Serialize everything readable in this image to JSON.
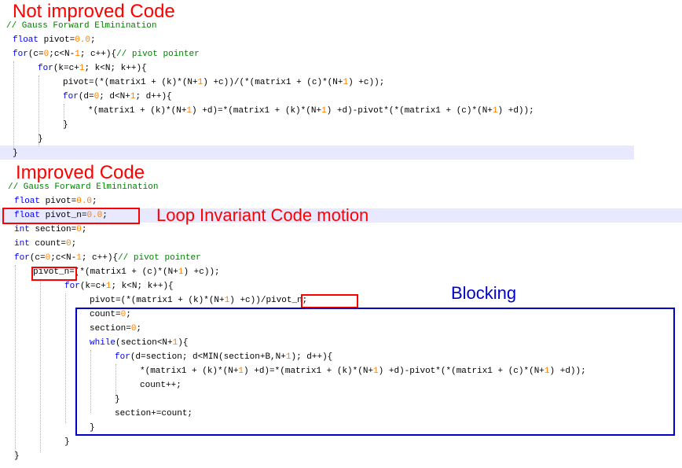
{
  "headings": {
    "not_improved": "Not improved Code",
    "improved": "Improved Code"
  },
  "annotations": {
    "loop_invariant": "Loop Invariant Code motion",
    "blocking": "Blocking"
  },
  "colors": {
    "heading": "#ff0000",
    "keyword": "#0000ff",
    "comment": "#008000",
    "number": "#ff8000",
    "loop_invariant_box": "#ff0000",
    "blocking_box": "#0000cc",
    "line_highlight": "#e8e8ff"
  },
  "code_before": [
    "// Gauss Forward Elminination",
    "float pivot=0.0;",
    "for(c=0;c<N-1; c++){// pivot pointer",
    "    for(k=c+1; k<N; k++){",
    "        pivot=(*(matrix1 + (k)*(N+1) +c))/(*(matrix1 + (c)*(N+1) +c));",
    "        for(d=0; d<N+1; d++){",
    "            *(matrix1 + (k)*(N+1) +d)=*(matrix1 + (k)*(N+1) +d)-pivot*(*(matrix1 + (c)*(N+1) +d));",
    "        }",
    "    }",
    "}"
  ],
  "code_after": [
    "// Gauss Forward Elminination",
    "float pivot=0.0;",
    "float pivot_n=0.0;",
    "int section=0;",
    "int count=0;",
    "for(c=0;c<N-1; c++){// pivot pointer",
    "    pivot_n=(*(matrix1 + (c)*(N+1) +c));",
    "        for(k=c+1; k<N; k++){",
    "            pivot=(*(matrix1 + (k)*(N+1) +c))/pivot_n;",
    "            count=0;",
    "            section=0;",
    "            while(section<N+1){",
    "                for(d=section; d<MIN(section+B,N+1); d++){",
    "                    *(matrix1 + (k)*(N+1) +d)=*(matrix1 + (k)*(N+1) +d)-pivot*(*(matrix1 + (c)*(N+1) +d));",
    "                    count++;",
    "                }",
    "                section+=count;",
    "            }",
    "        }",
    "}"
  ]
}
